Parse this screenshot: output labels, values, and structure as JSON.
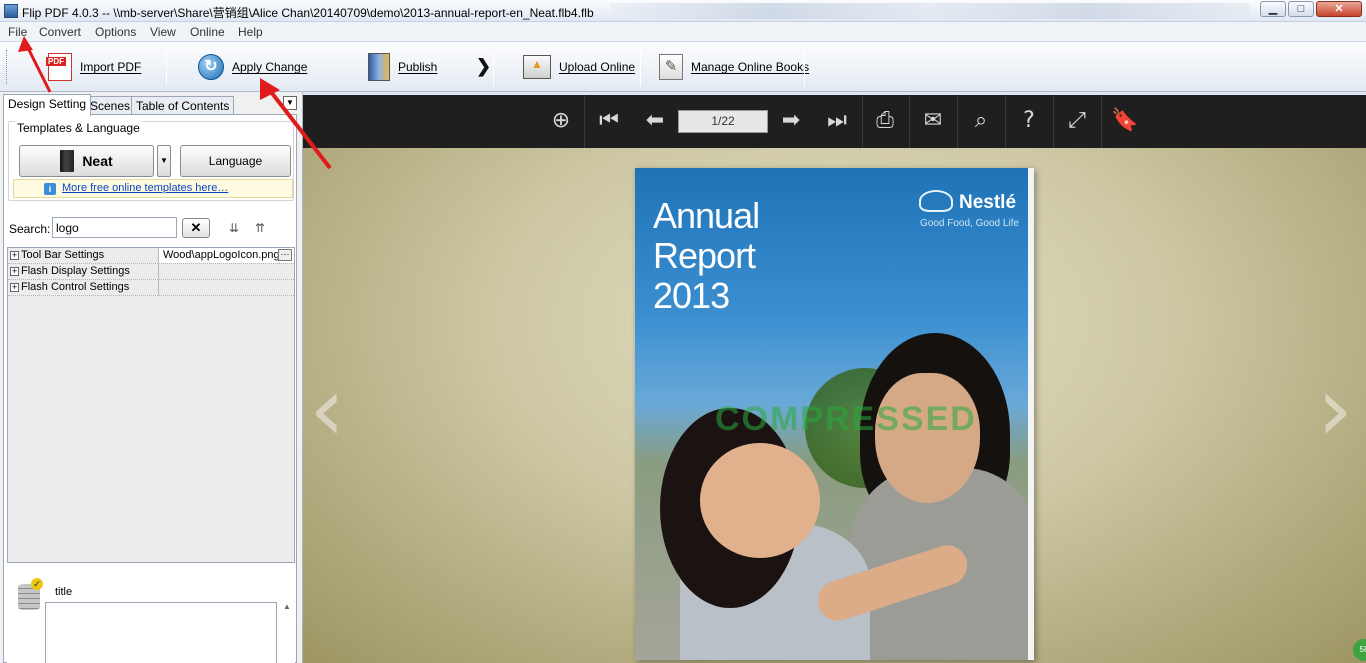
{
  "window": {
    "title": "Flip PDF 4.0.3  -- \\\\mb-server\\Share\\营销组\\Alice Chan\\20140709\\demo\\2013-annual-report-en_Neat.flb4.flb",
    "minimize_label": "▁",
    "maximize_label": "□",
    "close_label": "✕"
  },
  "menu": {
    "items": [
      "File",
      "Convert",
      "Options",
      "View",
      "Online",
      "Help"
    ]
  },
  "toolbar": {
    "import_label": "Import PDF",
    "apply_label": "Apply Change",
    "publish_label": "Publish",
    "more_label": "❯",
    "upload_label": "Upload Online",
    "manage_label": "Manage Online Books"
  },
  "left_panel": {
    "tabs": [
      "Design Setting",
      "Scenes",
      "Table of Contents"
    ],
    "active_tab": "Design Setting",
    "group_title": "Templates & Language",
    "template_name": "Neat",
    "language_label": "Language",
    "templates_link": "More free online templates here…",
    "search_label": "Search:",
    "search_value": "logo",
    "clear_label": "✕",
    "properties": [
      {
        "name": "Tool Bar Settings",
        "value": "Wood\\appLogoIcon.png"
      },
      {
        "name": "Flash Display Settings",
        "value": ""
      },
      {
        "name": "Flash Control Settings",
        "value": ""
      }
    ],
    "bottom_title": "title"
  },
  "viewer": {
    "page_indicator": "1/22",
    "icons": [
      "zoom-in-icon",
      "first-page-icon",
      "previous-page-icon",
      "next-page-icon",
      "last-page-icon",
      "print-icon",
      "email-icon",
      "search-icon",
      "help-icon",
      "fullscreen-icon",
      "bookmark-icon"
    ],
    "cover": {
      "title": "Annual\nReport\n2013",
      "brand": "Nestlé",
      "tagline": "Good Food, Good Life",
      "watermark": "COMPRESSED"
    }
  },
  "colors": {
    "annotation_arrow": "#e01b1b",
    "viewer_toolbar": "#1f1f1f",
    "link": "#0b44c9"
  }
}
